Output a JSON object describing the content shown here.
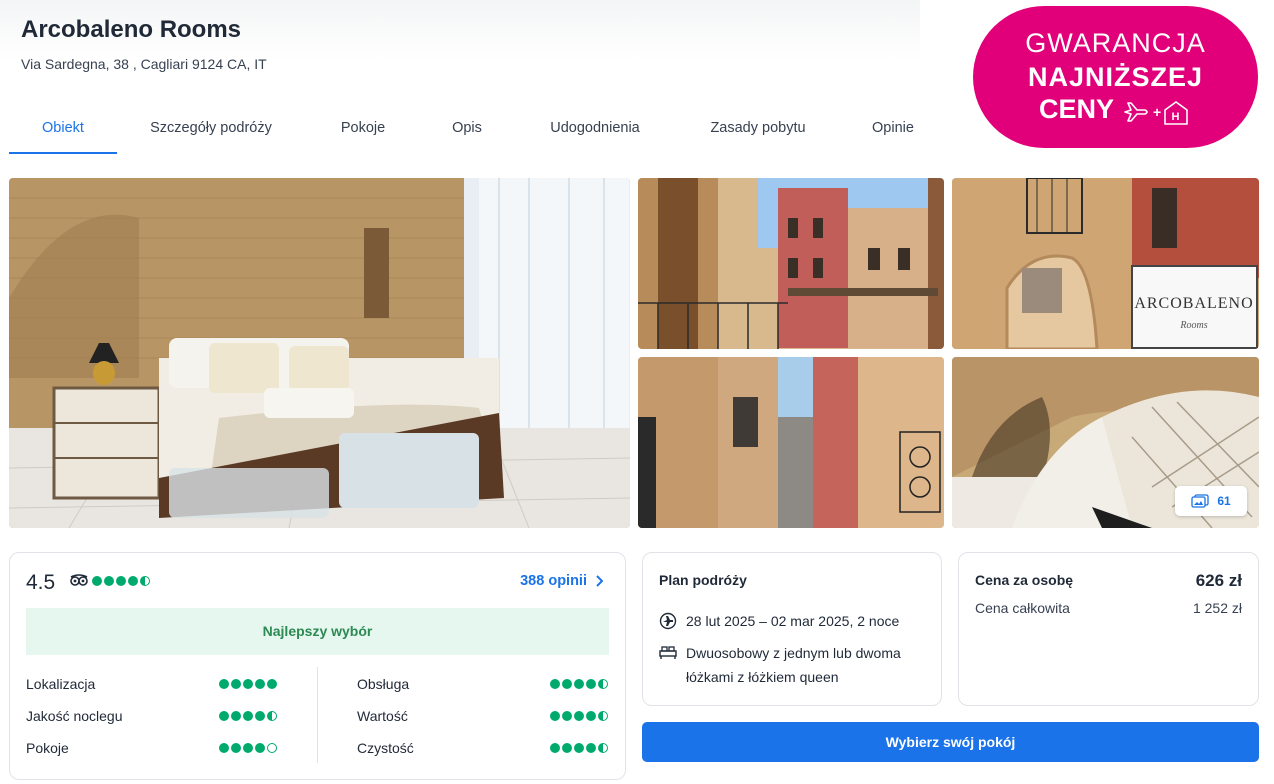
{
  "hotel": {
    "name": "Arcobaleno Rooms",
    "address": "Via Sardegna, 38 , Cagliari 9124 CA, IT"
  },
  "tabs": [
    {
      "label": "Obiekt",
      "active": true
    },
    {
      "label": "Szczegóły podróży",
      "active": false
    },
    {
      "label": "Pokoje",
      "active": false
    },
    {
      "label": "Opis",
      "active": false
    },
    {
      "label": "Udogodnienia",
      "active": false
    },
    {
      "label": "Zasady pobytu",
      "active": false
    },
    {
      "label": "Opinie",
      "active": false
    }
  ],
  "badge": {
    "line1": "GWARANCJA",
    "line2": "NAJNIŻSZEJ",
    "line3": "CENY",
    "icons": [
      "plane-icon",
      "hotel-icon"
    ],
    "plus": "+",
    "hotel_letter": "H"
  },
  "gallery": {
    "photo_count": "61",
    "photo_icon": "photos-icon"
  },
  "rating": {
    "score": "4.5",
    "score_value": 4.5,
    "reviews_link": "388 opinii",
    "best_choice": "Najlepszy wybór",
    "left": [
      {
        "label": "Lokalizacja",
        "value": 5
      },
      {
        "label": "Jakość noclegu",
        "value": 4.5
      },
      {
        "label": "Pokoje",
        "value": 4
      }
    ],
    "right": [
      {
        "label": "Obsługa",
        "value": 4.5
      },
      {
        "label": "Wartość",
        "value": 4.5
      },
      {
        "label": "Czystość",
        "value": 4.5
      }
    ],
    "dot_color": "#00aa6c"
  },
  "plan": {
    "title": "Plan podróży",
    "dates": "28 lut 2025 – 02 mar 2025, 2 noce",
    "room_line1": "Dwuosobowy z jednym lub dwoma",
    "room_line2": "łóżkami z łóżkiem queen"
  },
  "price": {
    "per_person_label": "Cena za osobę",
    "per_person_value": "626 zł",
    "total_label": "Cena całkowita",
    "total_value": "1 252 zł"
  },
  "cta": {
    "label": "Wybierz swój pokój"
  },
  "colors": {
    "accent": "#1a73e8",
    "badge": "#e2007a",
    "rating_green": "#00aa6c"
  }
}
